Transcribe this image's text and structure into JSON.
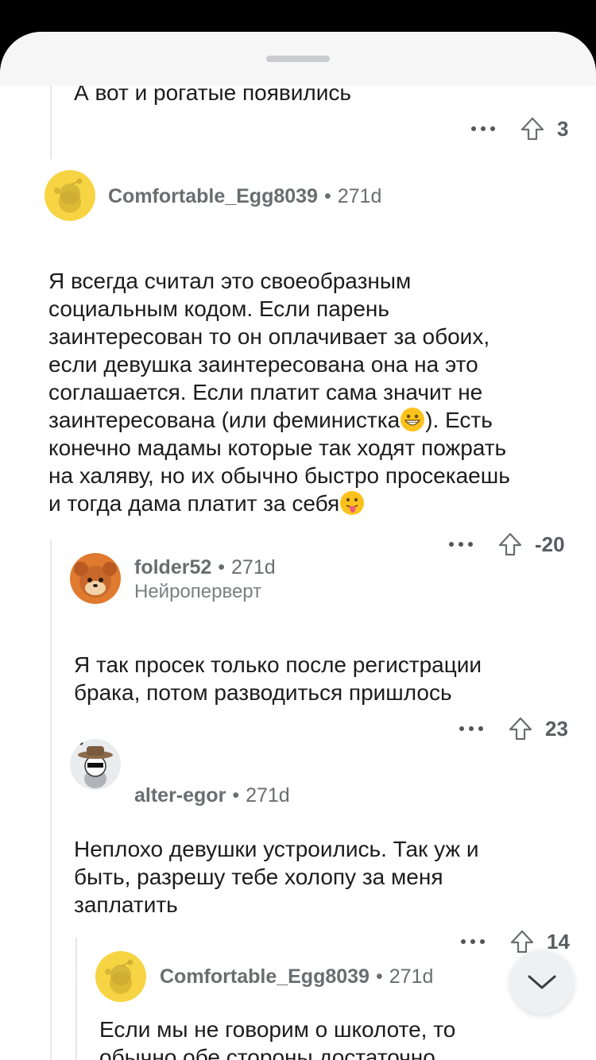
{
  "comments": [
    {
      "text": "А вот и рогатые появились",
      "score": "3"
    },
    {
      "author": "Comfortable_Egg8039",
      "age": "271d",
      "text_lines": [
        "Я всегда считал это своеобразным",
        "социальным кодом. Если парень",
        "заинтересован то он оплачивает за обоих,",
        "если девушка заинтересована она на это",
        "соглашается. Если платит сама значит не",
        "заинтересована (или феминистка",
        "). Есть",
        "конечно мадамы которые так ходят пожрать",
        "на халяву, но их обычно быстро просекаешь",
        "и тогда дама платит за себя"
      ],
      "score": "-20"
    },
    {
      "author": "folder52",
      "age": "271d",
      "flair": "Нейроперверт",
      "text": "Я так просек только после регистрации\nбрака, потом разводиться пришлось",
      "score": "23"
    },
    {
      "author": "alter-egor",
      "age": "271d",
      "text": "Неплохо девушки устроились. Так уж и\nбыть, разрешу тебе холопу за меня\nзаплатить",
      "score": "14"
    },
    {
      "author": "Comfortable_Egg8039",
      "age": "271d",
      "text": "Если мы не говорим о школоте, то\nобычно обе стороны достаточно"
    }
  ],
  "separator": "•",
  "icons": {
    "more": "more-horizontal-icon",
    "upvote": "arrow-up-icon",
    "scroll": "chevron-down-icon"
  },
  "colors": {
    "meta": "#6a6d70",
    "thread_line": "#e4e6e8",
    "avatar_yellow": "#f7d443"
  }
}
